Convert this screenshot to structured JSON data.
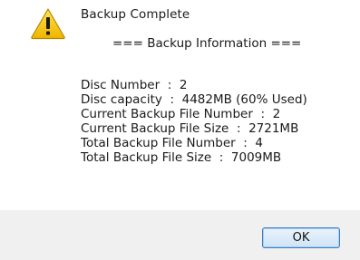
{
  "dialog": {
    "icon": "warning-triangle-icon",
    "title": "Backup Complete",
    "info_header": "=== Backup Information ===",
    "info_lines": [
      "Disc Number  :  2",
      "Disc capacity  :  4482MB (60% Used)",
      "Current Backup File Number  :  2",
      "Current Backup File Size  :  2721MB",
      "Total Backup File Number  :  4",
      "Total Backup File Size  :  7009MB"
    ],
    "ok_label": "OK"
  },
  "colors": {
    "warning_yellow": "#f5c400",
    "footer_background": "#f0f0f0",
    "button_border": "#3d7bbf"
  }
}
